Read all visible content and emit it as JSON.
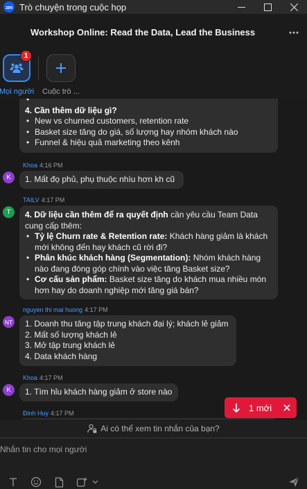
{
  "window": {
    "title": "Trò chuyện trong cuộc họp",
    "app_logo": "zm"
  },
  "header": {
    "title": "Workshop Online: Read the Data, Lead the Business"
  },
  "tabs": {
    "people": {
      "label": "Mọi người",
      "badge": "1"
    },
    "chat": {
      "label": "Cuộc trò ..."
    }
  },
  "messages": [
    {
      "id": "partial",
      "heading": "4. Cần thêm dữ liệu gì?",
      "items": [
        "New vs churned customers, retention rate",
        "Basket size tăng do giá, số lượng hay nhóm khách nào",
        "Funnel & hiệu quả marketing theo kênh"
      ]
    },
    {
      "sender": "Khoa",
      "time": "4:16 PM",
      "initial": "K",
      "text": "1. Mất đọ phủ, phụ thuộc nhìu hơn kh cũ"
    },
    {
      "sender": "TAILV",
      "time": "4:17 PM",
      "initial": "T",
      "intro_bold": "4. Dữ liệu cần thêm để ra quyết định",
      "intro_rest": " cần yêu cầu Team Data cung cấp thêm:",
      "items": [
        {
          "bold": "Tỷ lệ Churn rate & Retention rate:",
          "text": " Khách hàng giảm là khách mới không đến hay khách cũ rời đi?"
        },
        {
          "bold": "Phân khúc khách hàng (Segmentation):",
          "text": " Nhóm khách hàng nào đang đóng góp chính vào việc tăng Basket size?"
        },
        {
          "bold": "Cơ cấu sản phẩm:",
          "text": " Basket size tăng do khách mua nhiều món hơn hay do doanh nghiệp mới tăng giá bán?"
        }
      ]
    },
    {
      "sender": "nguyen thi mai huong",
      "time": "4:17 PM",
      "initial": "NT",
      "lines": [
        "1. Doanh thu tăng tập trung khách đại lý; khách lẻ giảm",
        "2. Mất số lượng khách lẻ",
        "3. Mở tập trung khách lẻ",
        "4. Data khách hàng"
      ]
    },
    {
      "sender": "Khoa",
      "time": "4:17 PM",
      "initial": "K",
      "text": "1. Tìm hỉu khách hàng giảm ở store nào"
    },
    {
      "sender": "Đinh Huy",
      "time": "4:17 PM"
    }
  ],
  "new_messages": {
    "label": "1 mới"
  },
  "who_can_see": "Ai có thể xem tin nhắn của bạn?",
  "composer": {
    "placeholder": "Nhắn tin cho mọi người"
  },
  "colors": {
    "accent": "#2d8cff",
    "badge": "#e02828",
    "new_pill": "#e0193a",
    "avatar_k": "#8e3fd1",
    "avatar_t": "#1f9d55"
  }
}
